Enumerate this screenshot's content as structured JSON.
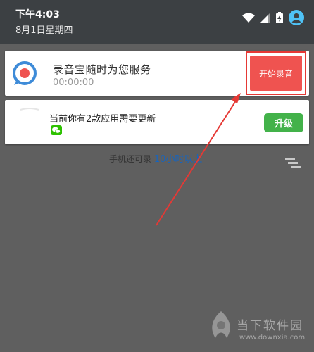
{
  "status_bar": {
    "time": "下午4:03",
    "date": "8月1日星期四"
  },
  "record_notification": {
    "title": "录音宝随时为您服务",
    "timer": "00:00:00",
    "button_label": "开始录音"
  },
  "update_notification": {
    "title": "当前你有2款应用需要更新",
    "button_label": "升级"
  },
  "storage": {
    "prefix": "手机还可录",
    "highlight": "10小时以上"
  },
  "watermark": {
    "name": "当下软件园",
    "url": "www.downxia.com"
  },
  "colors": {
    "record_button": "#ef5350",
    "highlight_frame": "#e53935",
    "update_button": "#43b24a",
    "shade": "#3c4043",
    "background": "#5f5f5f"
  }
}
